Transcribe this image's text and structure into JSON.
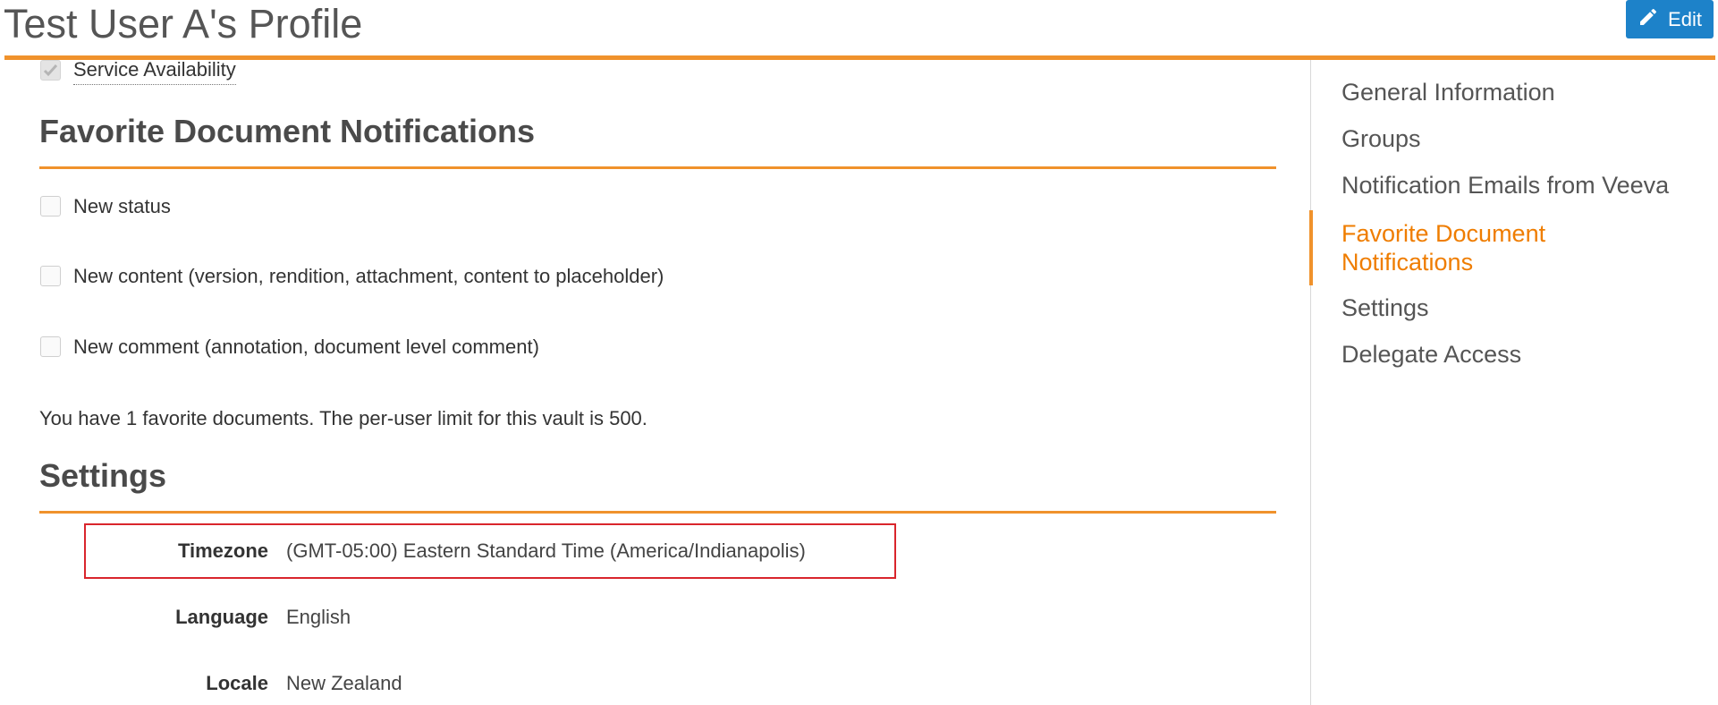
{
  "header": {
    "title": "Test User A's Profile",
    "edit_label": "Edit"
  },
  "content": {
    "service_availability": {
      "label": "Service Availability",
      "checked": true
    },
    "favorite_notifications": {
      "heading": "Favorite Document Notifications",
      "options": [
        {
          "label": "New status",
          "checked": false
        },
        {
          "label": "New content (version, rendition, attachment, content to placeholder)",
          "checked": false
        },
        {
          "label": "New comment (annotation, document level comment)",
          "checked": false
        }
      ],
      "info": "You have 1 favorite documents. The per-user limit for this vault is 500."
    },
    "settings": {
      "heading": "Settings",
      "rows": [
        {
          "label": "Timezone",
          "value": "(GMT-05:00) Eastern Standard Time (America/Indianapolis)"
        },
        {
          "label": "Language",
          "value": "English"
        },
        {
          "label": "Locale",
          "value": "New Zealand"
        }
      ]
    }
  },
  "sidebar": {
    "items": [
      {
        "label": "General Information"
      },
      {
        "label": "Groups"
      },
      {
        "label": "Notification Emails from Veeva"
      },
      {
        "label": "Favorite Document Notifications",
        "active": true
      },
      {
        "label": "Settings"
      },
      {
        "label": "Delegate Access"
      }
    ]
  },
  "colors": {
    "accent": "#f0922c",
    "active_nav": "#ef7d00",
    "edit_button": "#1d82c9",
    "highlight_border": "#d9252c"
  }
}
